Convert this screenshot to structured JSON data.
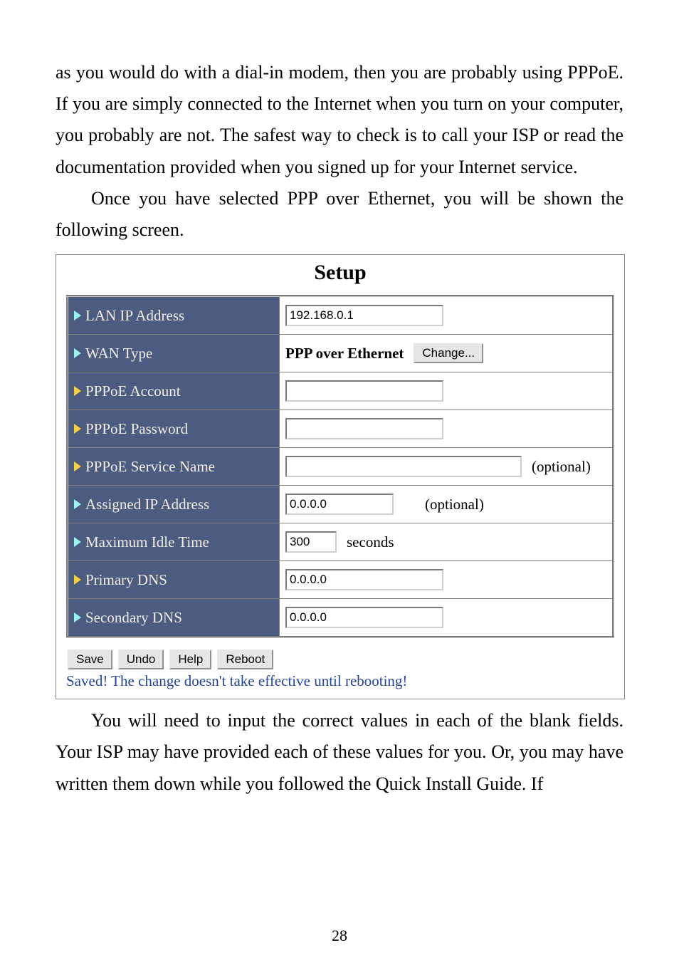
{
  "paragraph1": "as you would do with a dial-in modem, then you are probably using PPPoE. If you are simply connected to the Internet when you turn on your computer, you probably are not. The safest way to check is to call your ISP or read the documentation provided when you signed up for your Internet service.",
  "paragraph2": "Once you have selected PPP over Ethernet, you will be shown the following screen.",
  "paragraph3": "You will need to input the correct values in each of the blank fields. Your ISP may have provided each of these values for you. Or, you may have written them down while you followed the Quick Install Guide. If",
  "setup": {
    "title": "Setup",
    "rows": {
      "lan_ip": {
        "label": "LAN IP Address",
        "value": "192.168.0.1",
        "width": "210"
      },
      "wan_type": {
        "label": "WAN Type",
        "value": "PPP over Ethernet",
        "change": "Change..."
      },
      "pppoe_account": {
        "label": "PPPoE Account",
        "value": "",
        "width": "210"
      },
      "pppoe_password": {
        "label": "PPPoE Password",
        "value": "",
        "width": "210"
      },
      "pppoe_service": {
        "label": "PPPoE Service Name",
        "value": "",
        "width": "320",
        "suffix": "(optional)"
      },
      "assigned_ip": {
        "label": "Assigned IP Address",
        "value": "0.0.0.0",
        "width": "140",
        "suffix": "(optional)"
      },
      "max_idle": {
        "label": "Maximum Idle Time",
        "value": "300",
        "width": "60",
        "suffix": "seconds"
      },
      "primary_dns": {
        "label": "Primary DNS",
        "value": "0.0.0.0",
        "width": "210"
      },
      "secondary_dns": {
        "label": "Secondary DNS",
        "value": "0.0.0.0",
        "width": "210"
      }
    },
    "tri_colors": {
      "cyan": "#9bf3f0",
      "yellow": "#f3d142"
    },
    "buttons": {
      "save": "Save",
      "undo": "Undo",
      "help": "Help",
      "reboot": "Reboot"
    },
    "status": "Saved! The change doesn't take effective until rebooting!"
  },
  "page_number": "28"
}
